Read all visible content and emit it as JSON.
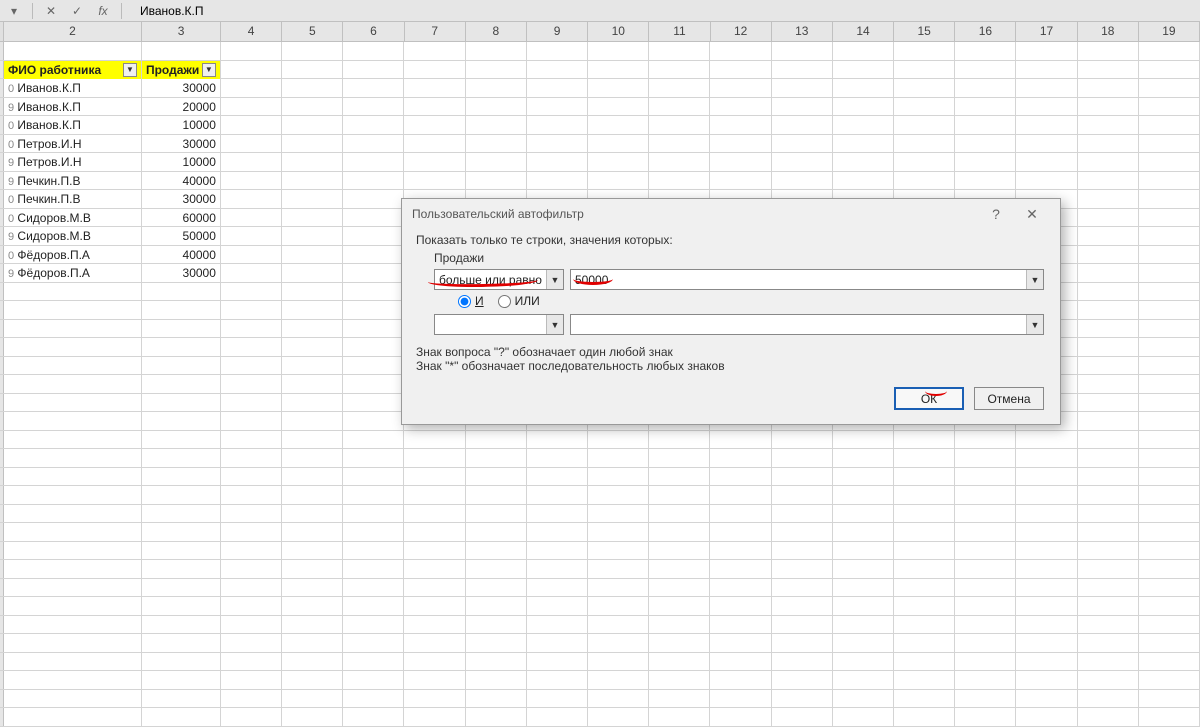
{
  "formula_bar": {
    "fx_label": "fx",
    "value": "Иванов.К.П"
  },
  "columns": [
    "2",
    "3",
    "4",
    "5",
    "6",
    "7",
    "8",
    "9",
    "10",
    "11",
    "12",
    "13",
    "14",
    "15",
    "16",
    "17",
    "18",
    "19"
  ],
  "headers": {
    "name": "ФИО работника",
    "sales": "Продажи"
  },
  "rows": [
    {
      "prefix": "0",
      "name": "Иванов.К.П",
      "sales": "30000"
    },
    {
      "prefix": "9",
      "name": "Иванов.К.П",
      "sales": "20000"
    },
    {
      "prefix": "0",
      "name": "Иванов.К.П",
      "sales": "10000"
    },
    {
      "prefix": "0",
      "name": "Петров.И.Н",
      "sales": "30000"
    },
    {
      "prefix": "9",
      "name": "Петров.И.Н",
      "sales": "10000"
    },
    {
      "prefix": "9",
      "name": "Печкин.П.В",
      "sales": "40000"
    },
    {
      "prefix": "0",
      "name": "Печкин.П.В",
      "sales": "30000"
    },
    {
      "prefix": "0",
      "name": "Сидоров.М.В",
      "sales": "60000"
    },
    {
      "prefix": "9",
      "name": "Сидоров.М.В",
      "sales": "50000"
    },
    {
      "prefix": "0",
      "name": "Фёдоров.П.А",
      "sales": "40000"
    },
    {
      "prefix": "9",
      "name": "Фёдоров.П.А",
      "sales": "30000"
    }
  ],
  "dialog": {
    "title": "Пользовательский автофильтр",
    "line1": "Показать только те строки, значения которых:",
    "field": "Продажи",
    "cond1_op": "больше или равно",
    "cond1_val": "50000",
    "radio_and": "И",
    "radio_or": "ИЛИ",
    "cond2_op": "",
    "cond2_val": "",
    "hint1": "Знак вопроса \"?\" обозначает один любой знак",
    "hint2": "Знак \"*\" обозначает последовательность любых знаков",
    "ok": "ОК",
    "cancel": "Отмена"
  }
}
